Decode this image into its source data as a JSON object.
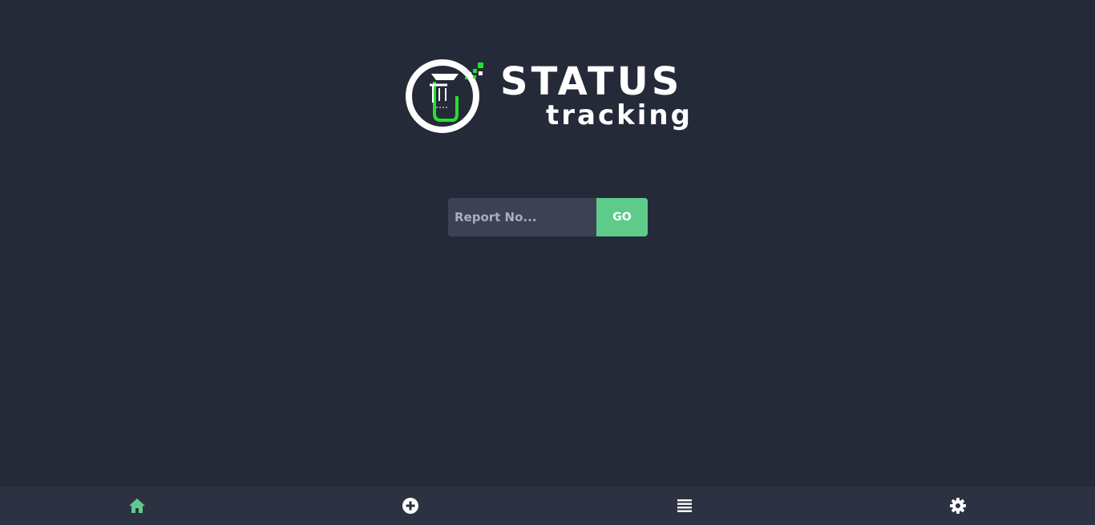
{
  "logo": {
    "line1": "STATUS",
    "line2": "tracking",
    "emblem_icon": "beaker-gauge-logo-icon",
    "accent_color": "#22e22c"
  },
  "search": {
    "placeholder": "Report No...",
    "value": "",
    "button_label": "GO"
  },
  "bottom_nav": {
    "items": [
      {
        "icon": "home-icon",
        "active": true
      },
      {
        "icon": "plus-circle-icon",
        "active": false
      },
      {
        "icon": "list-icon",
        "active": false
      },
      {
        "icon": "gear-icon",
        "active": false
      }
    ]
  },
  "colors": {
    "background": "#252a39",
    "nav_background": "#2d3242",
    "input_background": "#3c4253",
    "accent": "#5fcb8b",
    "text": "#ffffff"
  }
}
